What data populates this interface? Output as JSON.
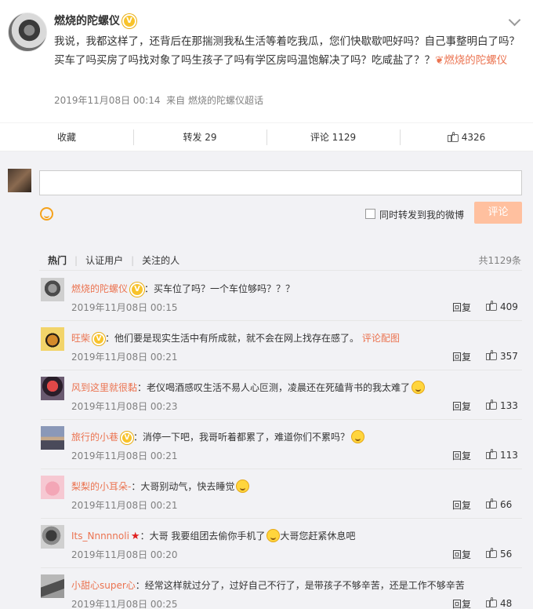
{
  "post": {
    "author": "燃烧的陀螺仪",
    "text": "我说，我都这样了，还背后在那揣测我私生活等着吃我瓜，您们快歇歇吧好吗？自己事整明白了吗？买车了吗买房了吗找对象了吗生孩子了吗有学区房吗温饱解决了吗？吃咸盐了？？",
    "topic_link": "燃烧的陀螺仪",
    "timestamp": "2019年11月08日 00:14",
    "source": "来自 燃烧的陀螺仪超话"
  },
  "actions": {
    "collect": "收藏",
    "forward": "转发 29",
    "comment": "评论 1129",
    "like": "4326"
  },
  "composer": {
    "forward_also": "同时转发到我的微博",
    "submit": "评论"
  },
  "tabs": {
    "hot": "热门",
    "verified": "认证用户",
    "followed": "关注的人",
    "total": "共1129条"
  },
  "comments": [
    {
      "user": "燃烧的陀螺仪",
      "text": "：买车位了吗？一个车位够吗？？？",
      "time": "2019年11月08日 00:15",
      "reply": "回复",
      "likes": "409"
    },
    {
      "user": "旺柴",
      "text": "：他们要是现实生活中有所成就，就不会在网上找存在感了。",
      "link": "评论配图",
      "time": "2019年11月08日 00:21",
      "reply": "回复",
      "likes": "357"
    },
    {
      "user": "风到这里就很黏",
      "text": "：老仪喝酒感叹生活不易人心叵测，凌晨还在死磕背书的我太难了",
      "time": "2019年11月08日 00:23",
      "reply": "回复",
      "likes": "133"
    },
    {
      "user": "旅行的小巷",
      "text": "：消停一下吧，我哥听着都累了，难道你们不累吗？",
      "time": "2019年11月08日 00:21",
      "reply": "回复",
      "likes": "113"
    },
    {
      "user": "梨梨的小耳朵-",
      "text": "：大哥别动气，快去睡觉",
      "time": "2019年11月08日 00:21",
      "reply": "回复",
      "likes": "66"
    },
    {
      "user": "Its_Nnnnnoli",
      "text": "：大哥 我要组团去偷你手机了",
      "text2": "大哥您赶紧休息吧",
      "time": "2019年11月08日 00:20",
      "reply": "回复",
      "likes": "56"
    },
    {
      "user": "小甜心super心",
      "text": "：经常这样就过分了，过好自己不行了，是带孩子不够辛苦，还是工作不够辛苦",
      "time": "2019年11月08日 00:25",
      "reply": "回复",
      "likes": "48"
    }
  ]
}
